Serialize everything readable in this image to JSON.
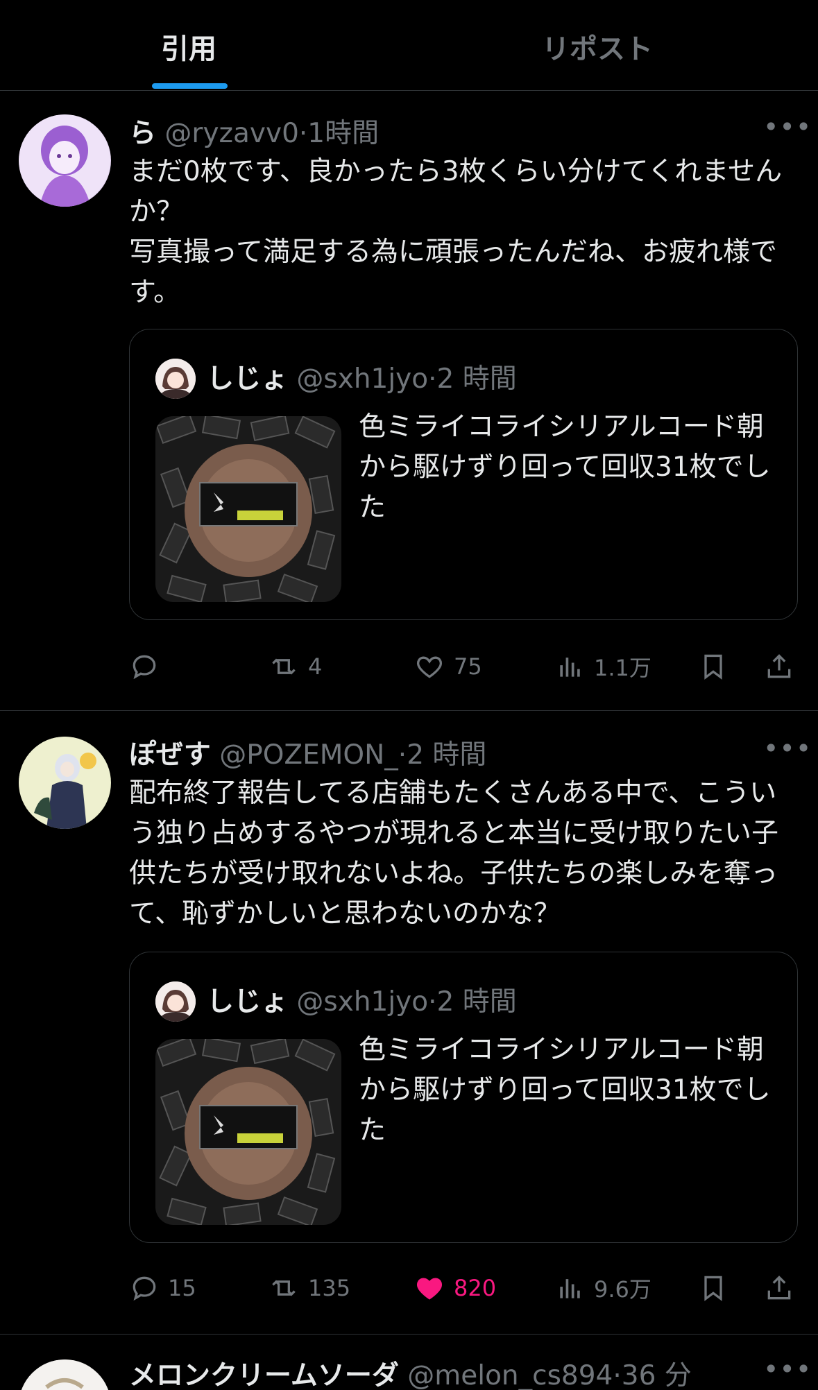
{
  "tabs": [
    {
      "label": "引用"
    },
    {
      "label": "リポスト"
    }
  ],
  "posts": [
    {
      "name": "ら",
      "handle": "@ryzavv0",
      "time": "1時間",
      "text": "まだ0枚です、良かったら3枚くらい分けてくれませんか？\n写真撮って満足する為に頑張ったんだね、お疲れ様です。",
      "quote": {
        "name": "しじょ",
        "handle": "@sxh1jyo",
        "time": "2 時間",
        "text": "色ミライコライシリアルコード朝から駆けずり回って回収31枚でした"
      },
      "replies": "",
      "reposts": "4",
      "likes": "75",
      "views": "1.1万",
      "liked": false
    },
    {
      "name": "ぽぜす",
      "handle": "@POZEMON_",
      "time": "2 時間",
      "text": "配布終了報告してる店舗もたくさんある中で、こういう独り占めするやつが現れると本当に受け取りたい子供たちが受け取れないよね。子供たちの楽しみを奪って、恥ずかしいと思わないのかな？",
      "quote": {
        "name": "しじょ",
        "handle": "@sxh1jyo",
        "time": "2 時間",
        "text": "色ミライコライシリアルコード朝から駆けずり回って回収31枚でした"
      },
      "replies": "15",
      "reposts": "135",
      "likes": "820",
      "views": "9.6万",
      "liked": true
    },
    {
      "name": "メロンクリームソーダ",
      "handle": "@melon_cs894",
      "time": "36 分"
    }
  ],
  "colors": {
    "accent": "#1d9bf0",
    "like": "#f91880",
    "muted": "#71767b"
  }
}
